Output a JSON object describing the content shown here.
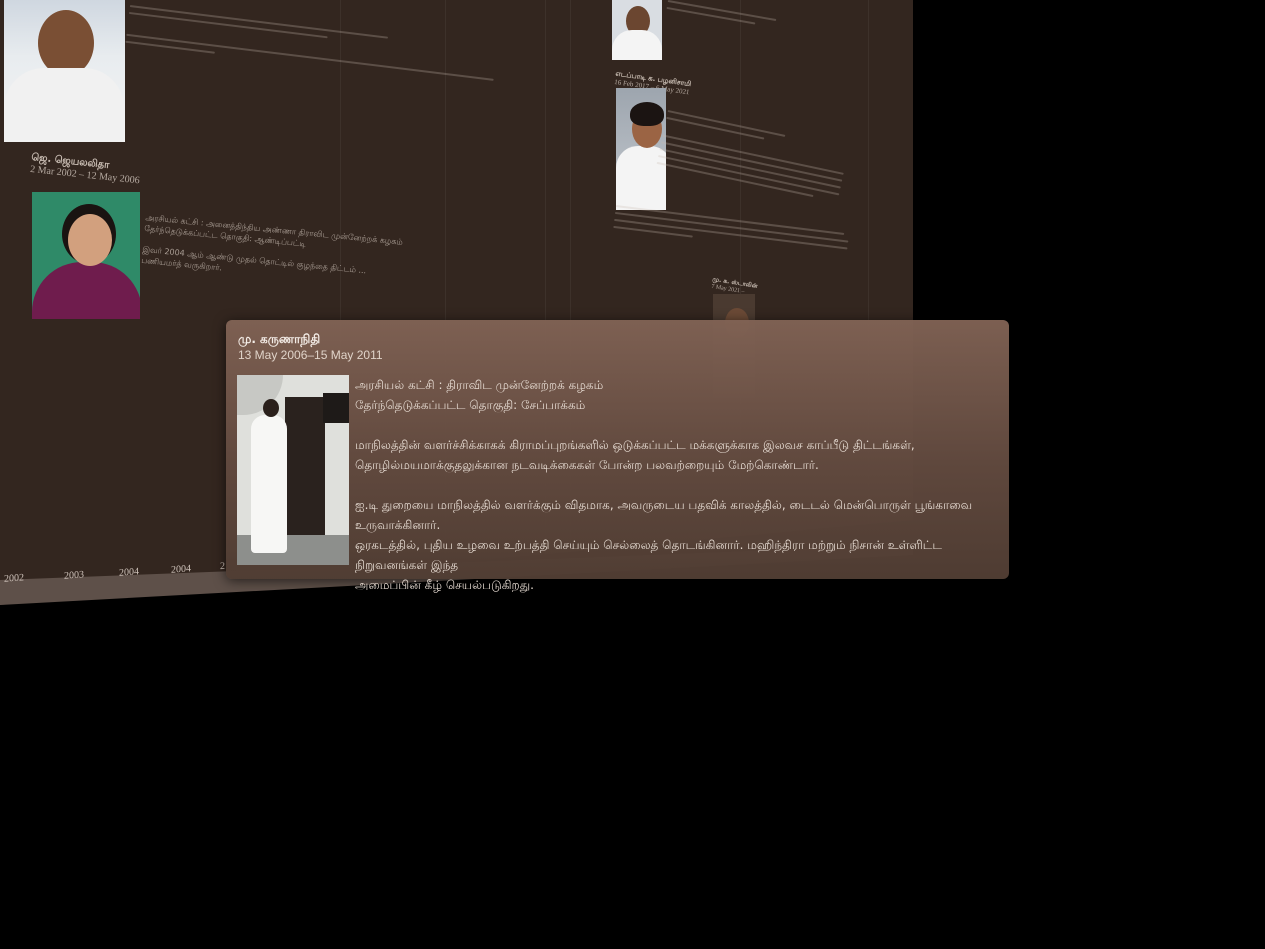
{
  "timeline": {
    "axis_years": [
      "2002",
      "2003",
      "2004",
      "2004",
      "2"
    ],
    "cards": [
      {
        "name": "ஜெ. ஜெயலலிதா",
        "dates": "2 Mar 2002 – 12 May 2006",
        "lines": [
          "அரசியல் கட்சி : அனைத்திந்திய அண்ணா திராவிட முன்னேற்றக் கழகம்",
          "தேர்ந்தெடுக்கப்பட்ட தொகுதி: ஆண்டிப்பட்டி",
          "இவர் 2004 ஆம் ஆண்டு முதல் தொட்டில் குழந்தை திட்டம் ...",
          "பணியமர்த் வருகிறார்."
        ]
      },
      {
        "name": "எடப்பாடி க. பழனிசாமி",
        "dates": "16 Feb 2017 – 6 May 2021"
      },
      {
        "name": "மு. க. ஸ்டாலின்",
        "dates": "7 May 2021 –"
      }
    ]
  },
  "popup": {
    "name": "மு. கருணாநிதி",
    "dates": "13 May 2006–15 May 2011",
    "party_line": "அரசியல் கட்சி : திராவிட முன்னேற்றக் கழகம்",
    "constituency_line": "தேர்ந்தெடுக்கப்பட்ட தொகுதி: சேப்பாக்கம்",
    "para1_line1": "மாநிலத்தின் வளர்ச்சிக்காகக் கிராமப்புறங்களில் ஒடுக்கப்பட்ட மக்களுக்காக இலவச காப்பீடு திட்டங்கள்,",
    "para1_line2": "தொழில்மயமாக்குதலுக்கான நடவடிக்கைகள் போன்ற பலவற்றையும் மேற்கொண்டார்.",
    "para2_line1": "ஐ.டி துறையை மாநிலத்தில் வளர்க்கும் விதமாக, அவருடைய பதவிக் காலத்தில், டைடல் மென்பொருள் பூங்காவை உருவாக்கினார்.",
    "para2_line2": "ஒரகடத்தில், புதிய உழவை உற்பத்தி செய்யும் செல்லைத் தொடங்கினார். மஹிந்திரா மற்றும் நிசான் உள்ளிட்ட நிறுவனங்கள் இந்த",
    "para2_line3": "அமைப்பின் கீழ் செயல்படுகிறது."
  }
}
